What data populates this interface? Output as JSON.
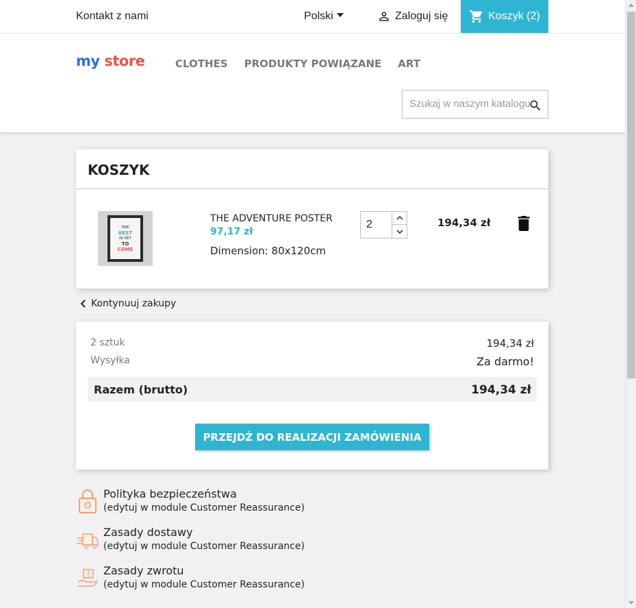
{
  "topbar": {
    "contact": "Kontakt z nami",
    "language": "Polski",
    "login": "Zaloguj się",
    "cart": "Koszyk (2)"
  },
  "header": {
    "logo_my": "my",
    "logo_store": "store",
    "nav": [
      "CLOTHES",
      "PRODUKTY POWIĄZANE",
      "ART"
    ],
    "search_placeholder": "Szukaj w naszym katalogu"
  },
  "cart": {
    "title": "KOSZYK",
    "item": {
      "thumb_text": [
        "THE",
        "BEST",
        "IS YET",
        "TO",
        "COME"
      ],
      "name": "THE ADVENTURE POSTER",
      "unit_price": "97,17 zł",
      "attribute": "Dimension: 80x120cm",
      "quantity": "2",
      "total": "194,34 zł"
    }
  },
  "continue_label": "Kontynuuj zakupy",
  "summary": {
    "items_label": "2 sztuk",
    "items_value": "194,34 zł",
    "shipping_label": "Wysyłka",
    "shipping_value": "Za darmo!",
    "total_label": "Razem (brutto)",
    "total_value": "194,34 zł",
    "checkout_label": "PRZEJDŹ DO REALIZACJI ZAMÓWIENIA"
  },
  "reassurance": [
    {
      "icon": "lock-icon",
      "title": "Polityka bezpieczeństwa",
      "sub": "(edytuj w module Customer Reassurance)"
    },
    {
      "icon": "delivery-truck-icon",
      "title": "Zasady dostawy",
      "sub": "(edytuj w module Customer Reassurance)"
    },
    {
      "icon": "return-package-icon",
      "title": "Zasady zwrotu",
      "sub": "(edytuj w module Customer Reassurance)"
    }
  ],
  "colors": {
    "accent": "#2fb5d2",
    "reassurance_icon": "#f39d72"
  }
}
